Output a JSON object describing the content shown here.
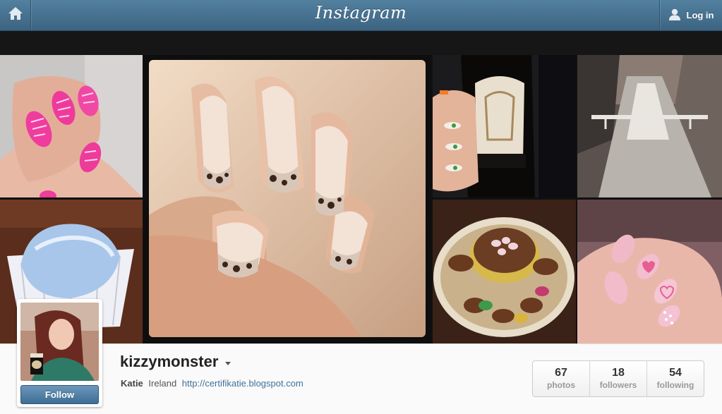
{
  "header": {
    "logo_text": "Instagram",
    "login_label": "Log in"
  },
  "profile": {
    "username": "kizzymonster",
    "full_name": "Katie",
    "location": "Ireland",
    "website": "http://certifikatie.blogspot.com",
    "follow_label": "Follow"
  },
  "stats": [
    {
      "value": "67",
      "label": "photos"
    },
    {
      "value": "18",
      "label": "followers"
    },
    {
      "value": "54",
      "label": "following"
    }
  ],
  "photos": [
    {
      "subject": "pink zebra nail art"
    },
    {
      "subject": "leopard print french tip nails"
    },
    {
      "subject": "guinness bottle with shamrock nails"
    },
    {
      "subject": "canal in sunlight"
    },
    {
      "subject": "blue cupcake in paper case"
    },
    {
      "subject": "chocolate easter nest cake"
    },
    {
      "subject": "pink heart and polka dot nails"
    }
  ],
  "icons": {
    "home": "home-icon",
    "user": "user-icon",
    "caret": "chevron-down-icon"
  },
  "colors": {
    "topbar": "#4a7696",
    "accent_link": "#3f729b",
    "follow_button": "#4f7ea5"
  }
}
